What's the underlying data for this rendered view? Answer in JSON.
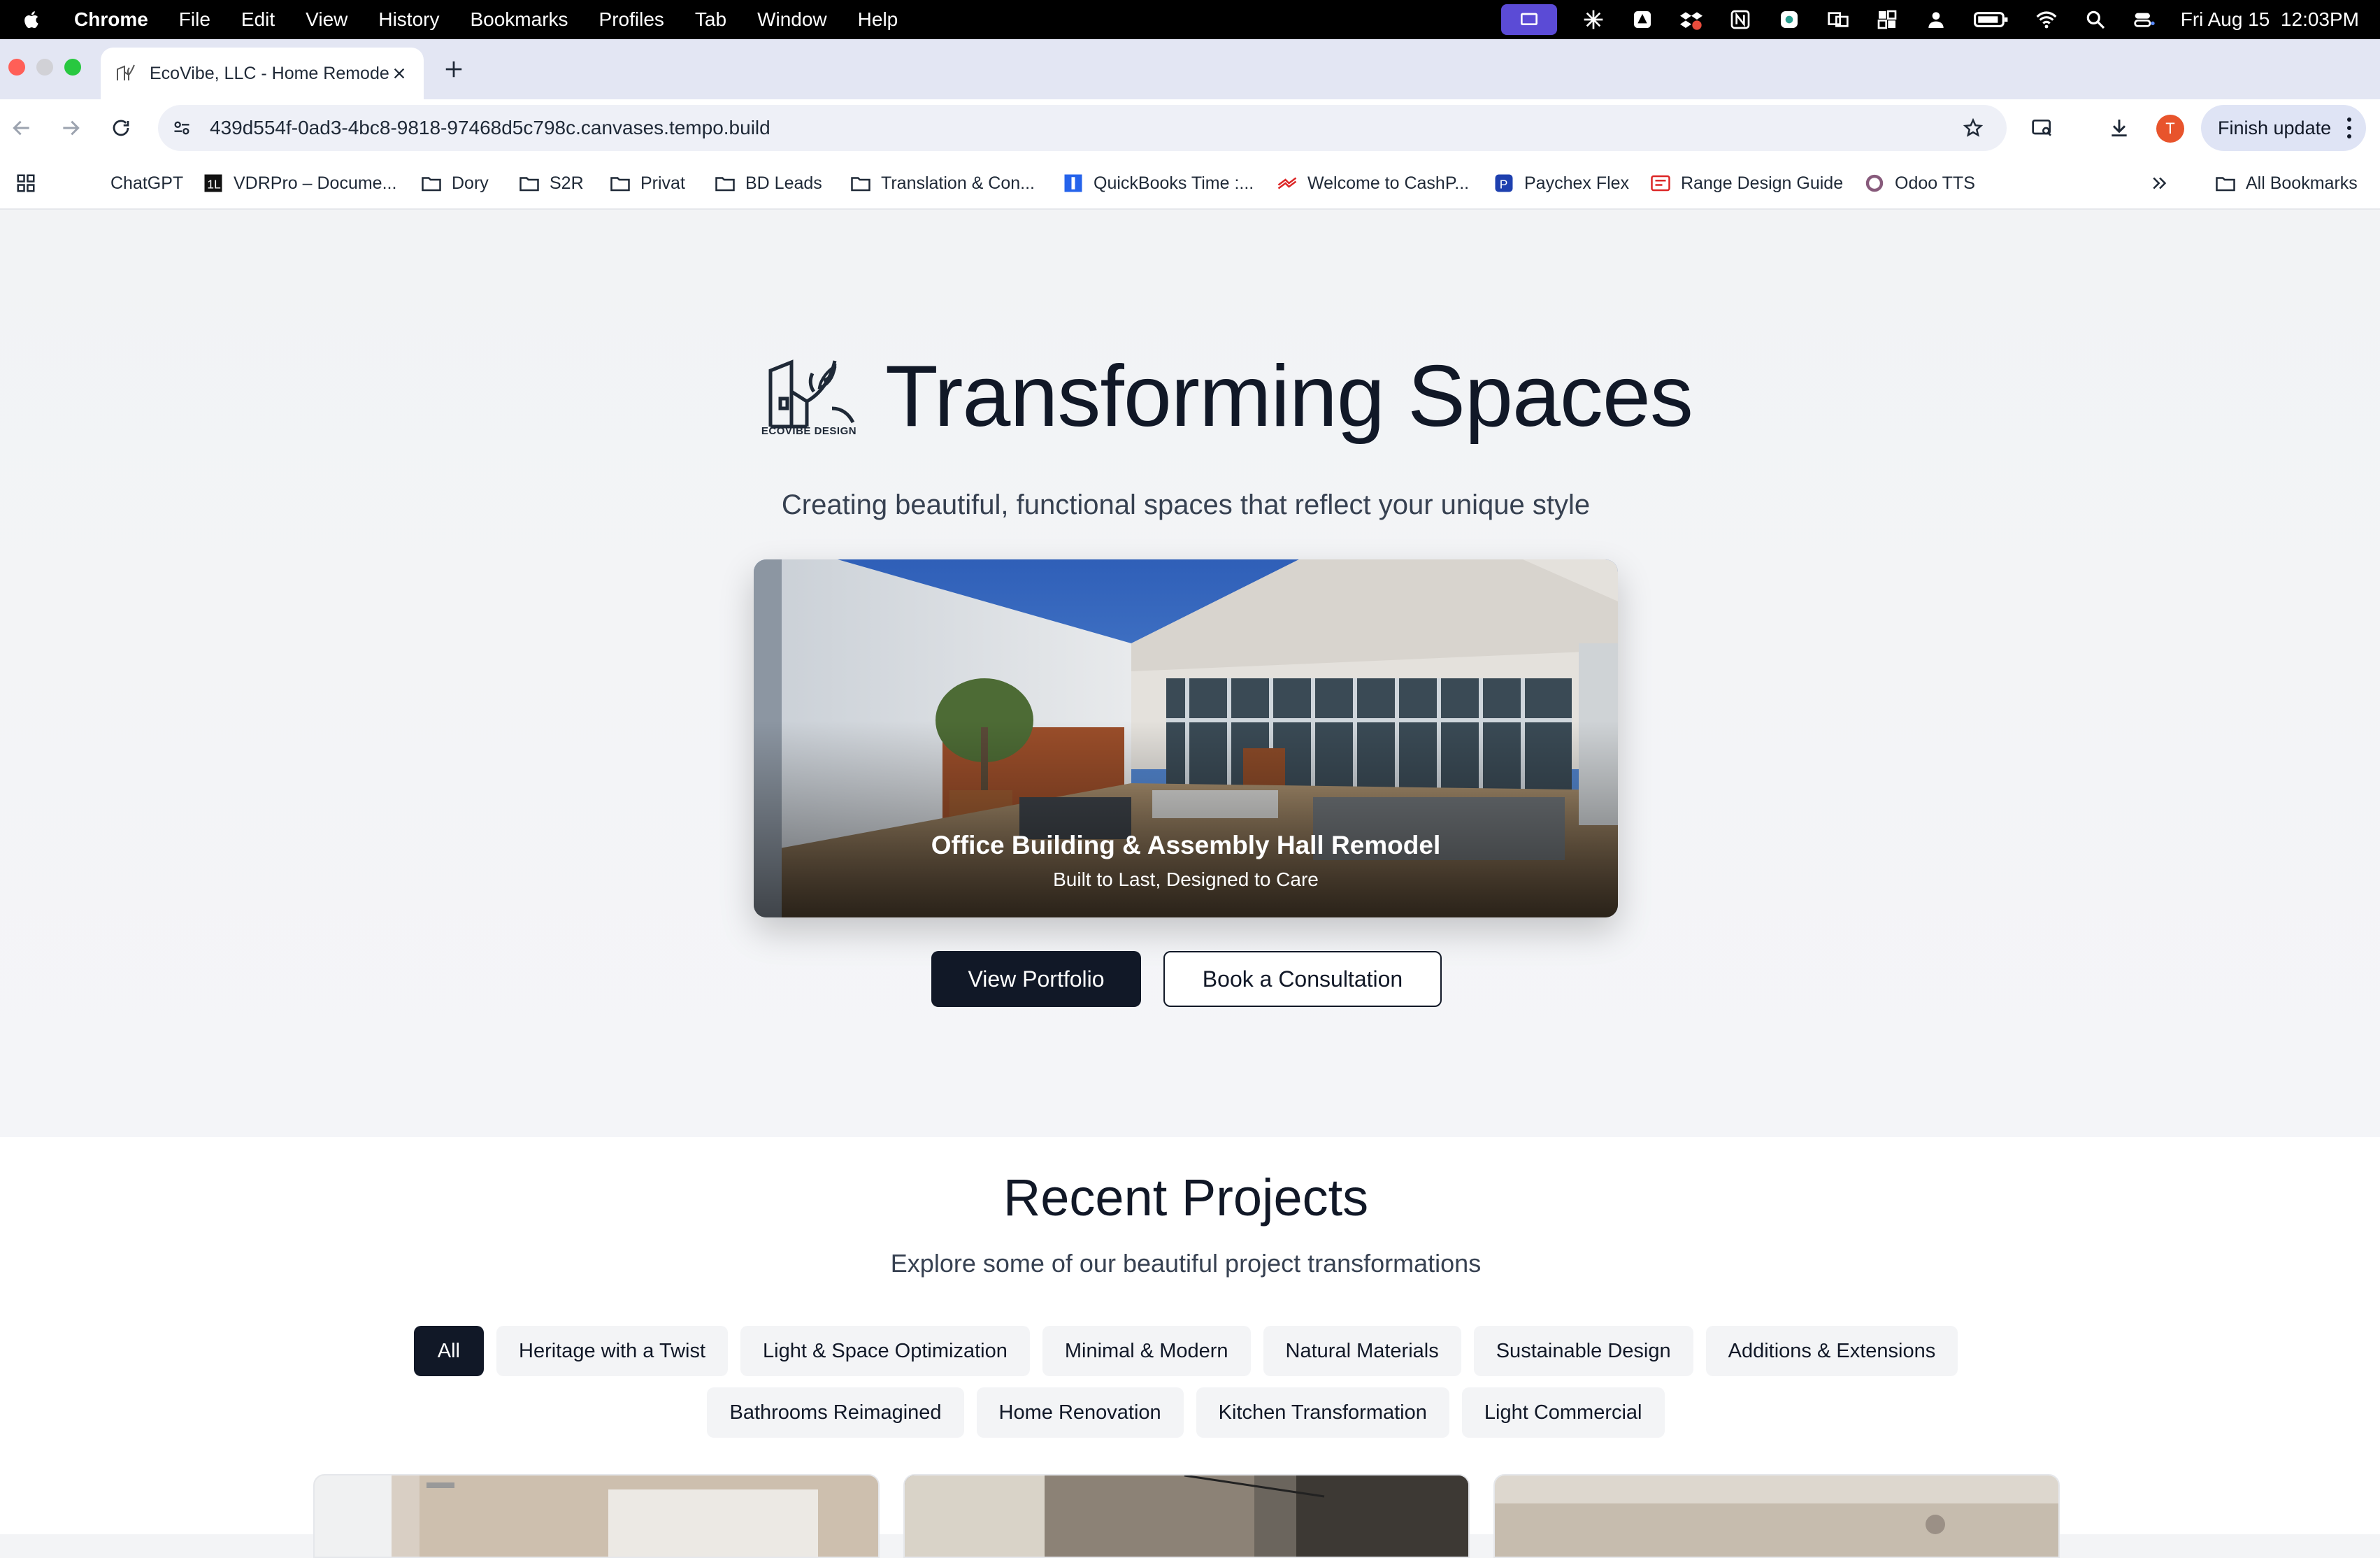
{
  "menubar": {
    "app": "Chrome",
    "items": [
      "File",
      "Edit",
      "View",
      "History",
      "Bookmarks",
      "Profiles",
      "Tab",
      "Window",
      "Help"
    ],
    "datetime": "Fri Aug 15  12:03PM"
  },
  "tab": {
    "title": "EcoVibe, LLC - Home Remodeling"
  },
  "toolbar": {
    "url": "439d554f-0ad3-4bc8-9818-97468d5c798c.canvases.tempo.build",
    "avatar_letter": "T",
    "finish_update": "Finish update"
  },
  "bookmarks": {
    "items": [
      "ChatGPT",
      "VDRPro – Docume...",
      "Dory",
      "S2R",
      "Privat",
      "BD Leads",
      "Translation & Con...",
      "QuickBooks Time :...",
      "Welcome to CashP...",
      "Paychex Flex",
      "Range Design Guide",
      "Odoo TTS"
    ],
    "all": "All Bookmarks"
  },
  "hero": {
    "logo_text": "ECOVIBE DESIGN",
    "title": "Transforming Spaces",
    "subtitle": "Creating beautiful, functional spaces that reflect your unique style",
    "card_title": "Office Building & Assembly Hall Remodel",
    "card_subtitle": "Built to Last, Designed to Care",
    "btn_portfolio": "View Portfolio",
    "btn_consult": "Book a Consultation"
  },
  "recent": {
    "title": "Recent Projects",
    "subtitle": "Explore some of our beautiful project transformations",
    "chips_row1": [
      "All",
      "Heritage with a Twist",
      "Light & Space Optimization",
      "Minimal & Modern",
      "Natural Materials",
      "Sustainable Design",
      "Additions & Extensions"
    ],
    "chips_row2": [
      "Bathrooms Reimagined",
      "Home Renovation",
      "Kitchen Transformation",
      "Light Commercial"
    ]
  },
  "colors": {
    "accent": "#111827",
    "avatar": "#e8542c",
    "menubar": "#000000"
  }
}
